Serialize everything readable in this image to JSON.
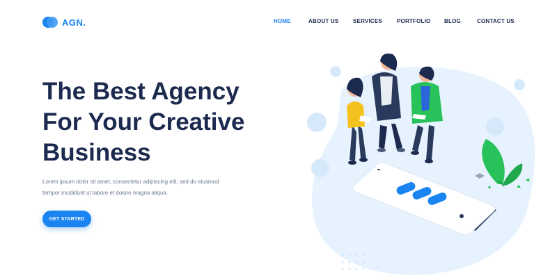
{
  "brand": {
    "name": "AGN.",
    "logo_icon": "overlapping-circles-logo",
    "color": "#1a84f0"
  },
  "nav": {
    "items": [
      {
        "label": "HOME",
        "active": true
      },
      {
        "label": "ABOUT US",
        "active": false
      },
      {
        "label": "SERVICES",
        "active": false
      },
      {
        "label": "PORTFOLIO",
        "active": false
      },
      {
        "label": "BLOG",
        "active": false
      },
      {
        "label": "CONTACT US",
        "active": false
      }
    ]
  },
  "hero": {
    "title_lines": [
      "The Best Agency",
      "For Your Creative",
      "Business"
    ],
    "description_lines": [
      "Lorem ipsum dolor sit amet, consectetur adipiscing elit, sed do eiusmod",
      "tempor incididunt ut labore et dolore magna aliqua."
    ],
    "cta_label": "GET STARTED"
  },
  "colors": {
    "accent": "#1a84f0",
    "heading": "#1b2a4e",
    "body_text": "#6b7a90",
    "blob": "#e6f2fd",
    "green": "#27c25a",
    "yellow": "#f4c21e"
  }
}
